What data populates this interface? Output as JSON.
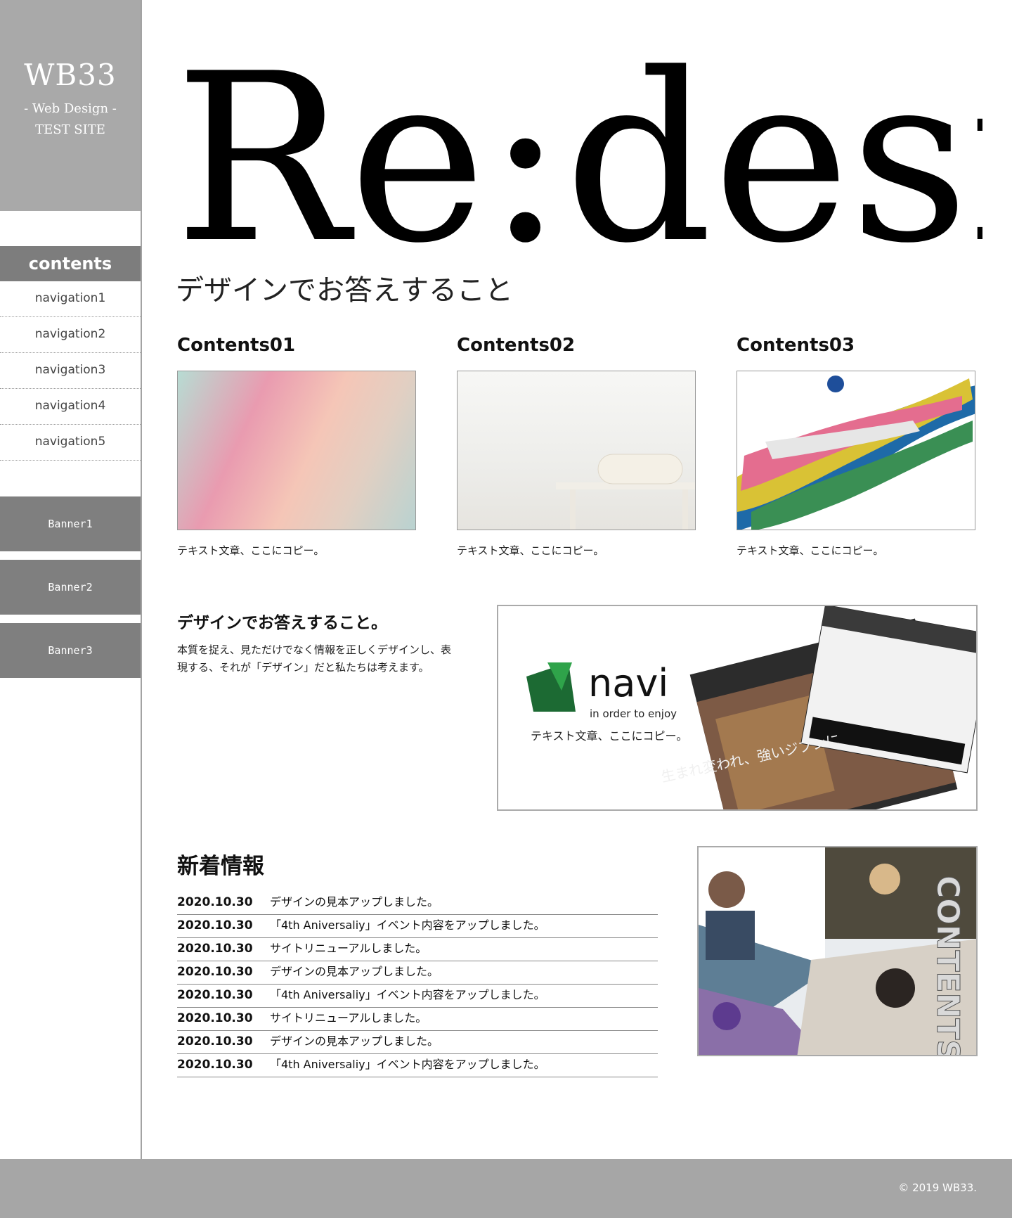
{
  "sidebar": {
    "logo": {
      "title": "WB33",
      "subtitle": "- Web Design -",
      "subtitle2": "TEST SITE"
    },
    "contents_label": "contents",
    "nav": [
      "navigation1",
      "navigation2",
      "navigation3",
      "navigation4",
      "navigation5"
    ],
    "banners": [
      "Banner1",
      "Banner2",
      "Banner3"
    ]
  },
  "hero": {
    "title": "Re:design",
    "subtitle": "デザインでお答えすること"
  },
  "columns": [
    {
      "title": "Contents01",
      "text": "テキスト文章、ここにコピー。"
    },
    {
      "title": "Contents02",
      "text": "テキスト文章、ここにコピー。"
    },
    {
      "title": "Contents03",
      "text": "テキスト文章、ここにコピー。"
    }
  ],
  "feature": {
    "heading": "デザインでお答えすること。",
    "body": "本質を捉え、見ただけでなく情報を正しくデザインし、表現する、それが「デザイン」だと私たちは考えます。",
    "image_logo": "navi",
    "image_tagline": "in order to enjoy",
    "image_caption": "テキスト文章、ここにコピー。",
    "image_banner": "生まれ変われ、強いジブンに"
  },
  "news": {
    "heading": "新着情報",
    "items": [
      {
        "date": "2020.10.30",
        "text": "デザインの見本アップしました。"
      },
      {
        "date": "2020.10.30",
        "text": "「4th Aniversaliy」イベント内容をアップしました。"
      },
      {
        "date": "2020.10.30",
        "text": "サイトリニューアルしました。"
      },
      {
        "date": "2020.10.30",
        "text": "デザインの見本アップしました。"
      },
      {
        "date": "2020.10.30",
        "text": "「4th Aniversaliy」イベント内容をアップしました。"
      },
      {
        "date": "2020.10.30",
        "text": "サイトリニューアルしました。"
      },
      {
        "date": "2020.10.30",
        "text": "デザインの見本アップしました。"
      },
      {
        "date": "2020.10.30",
        "text": "「4th Aniversaliy」イベント内容をアップしました。"
      }
    ]
  },
  "side_photo": {
    "label": "CONTENTS"
  },
  "footer": {
    "copyright": "© 2019 WB33."
  },
  "colors": {
    "sidebar_gray": "#a9a9a9",
    "banner_gray": "#7f7f7f",
    "footer_gray": "#a6a6a6"
  }
}
